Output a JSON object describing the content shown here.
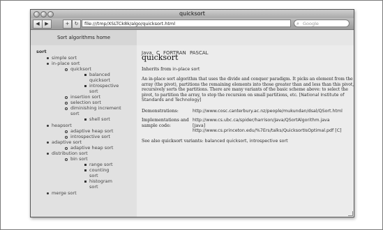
{
  "window": {
    "title": "quicksort",
    "url": "file:///tmp/XSLTCk8k/algo/quicksort.html",
    "search_placeholder": "Google",
    "back_label": "◀",
    "forward_label": "▶",
    "add_label": "+",
    "reload_label": "↻"
  },
  "sidebar": {
    "header": "Sort algorithms home",
    "tree": {
      "root": "sort",
      "simple_sort": "simple sort",
      "in_place_sort": "in-place sort",
      "quicksort": "quicksort",
      "balanced_quicksort_1": "balanced",
      "balanced_quicksort_2": "quicksort",
      "introspective_sort_1": "introspective",
      "introspective_sort_2": "sort",
      "insertion_sort": "insertion sort",
      "selection_sort": "selection sort",
      "diminishing_increment_sort_1": "diminishing increment",
      "diminishing_increment_sort_2": "sort",
      "shell_sort": "shell sort",
      "heapsort": "heapsort",
      "adaptive_heap_sort": "adaptive heap sort",
      "introspective_sort_b": "introspective sort",
      "adaptive_sort": "adaptive sort",
      "adaptive_heap_sort_b": "adaptive heap sort",
      "distribution_sort": "distribution sort",
      "bin_sort": "bin sort",
      "range_sort": "range sort",
      "counting_sort_1": "counting",
      "counting_sort_2": "sort",
      "histogram_sort_1": "histogram",
      "histogram_sort_2": "sort",
      "merge_sort": "merge sort"
    }
  },
  "nav": {
    "java": "Java",
    "c": "C",
    "fortran": "FORTRAN",
    "pascal": "PASCAL"
  },
  "main": {
    "title": "quicksort",
    "inherits_prefix": "Inherits from ",
    "inherits_link": "in-place sort",
    "description_1": "An in-place sort algorithm that uses the divide and conquer paradigm. It picks an element from the",
    "description_2": "array (the pivot), partitions the remaining elements into those greater than and less than this pivot, and",
    "description_3": "recursively sorts the partitions. There are many variants of the basic scheme above: to select the",
    "description_4": "pivot, to partition the array, to stop the recursion on small partitions, etc. ",
    "description_5": "[National Institute of",
    "description_6": "Standards and Technology]",
    "demonstrations_label": "Demonstrations:",
    "demonstrations_link": "http://www.cosc.canterbury.ac.nz/people/mukundan/dsal/QSort.html",
    "impl_label_1": "Implementations and",
    "impl_label_2": "sample code:",
    "impl_link_1": "http://www.cs.ubc.ca/spider/harrison/Java/QSortAlgorithm.java",
    "impl_tag_1": "[Java]",
    "impl_link_2": "http://www.cs.princeton.edu/%7Ers/talks/QuicksortIsOptimal.pdf",
    "impl_tag_2": "[C]",
    "see_also_prefix": "See also quicksort variants: ",
    "see_also_link_1": "balanced quicksort",
    "see_also_sep": ", ",
    "see_also_link_2": "introspective sort"
  }
}
